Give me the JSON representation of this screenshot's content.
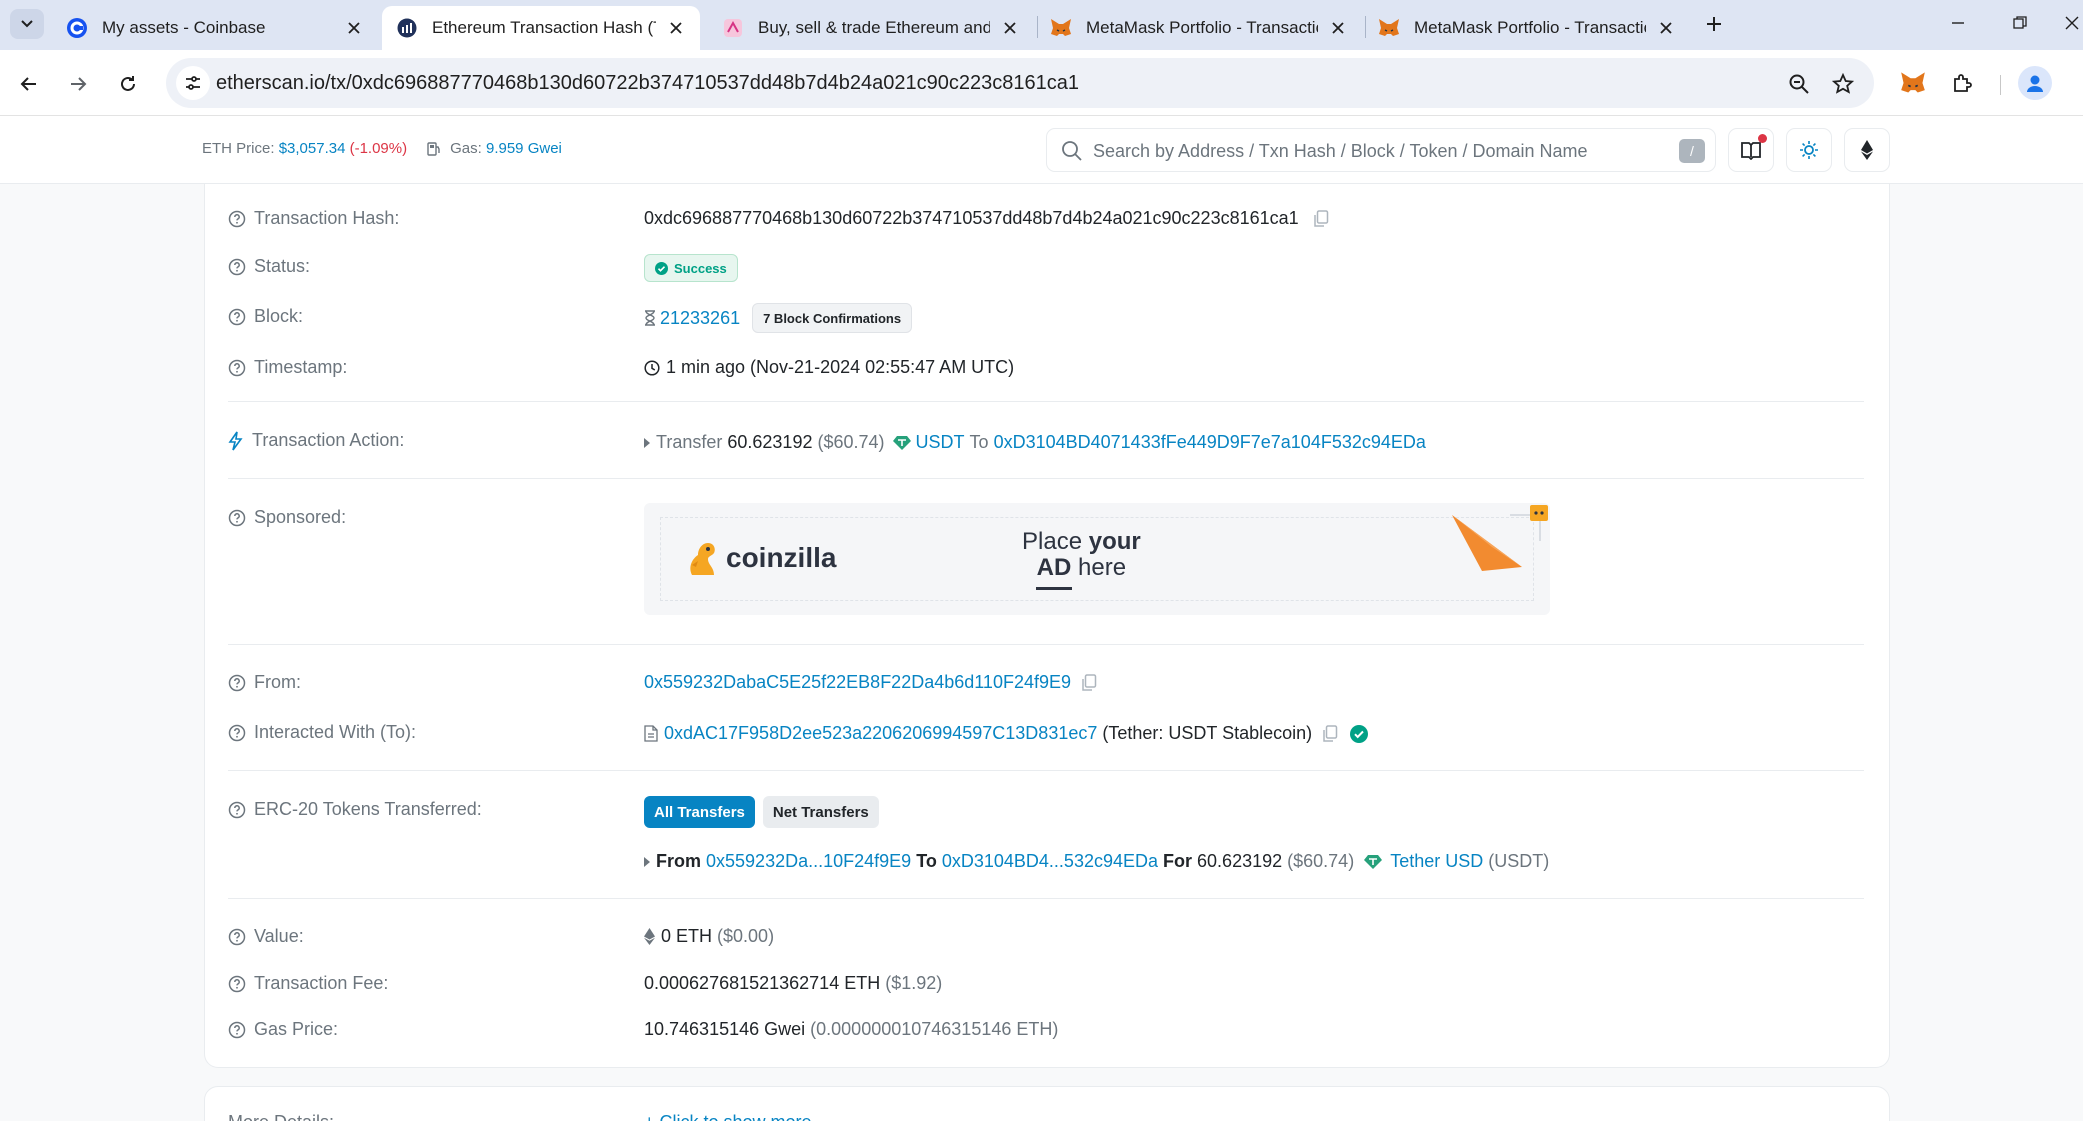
{
  "browser": {
    "tabs": [
      {
        "title": "My assets - Coinbase",
        "favicon": "coinbase-icon"
      },
      {
        "title": "Ethereum Transaction Hash (Txh",
        "favicon": "etherscan-icon"
      },
      {
        "title": "Buy, sell & trade Ethereum and",
        "favicon": "shop-icon"
      },
      {
        "title": "MetaMask Portfolio - Transactio",
        "favicon": "metamask-icon"
      },
      {
        "title": "MetaMask Portfolio - Transactio",
        "favicon": "metamask-icon"
      }
    ],
    "active_tab": 1,
    "url": "etherscan.io/tx/0xdc696887770468b130d60722b374710537dd48b7d4b24a021c90c223c8161ca1"
  },
  "header": {
    "eth_price_label": "ETH Price:",
    "eth_price": "$3,057.34",
    "eth_change": "(-1.09%)",
    "gas_label": "Gas:",
    "gas_value": "9.959 Gwei",
    "search_placeholder": "Search by Address / Txn Hash / Block / Token / Domain Name",
    "search_shortcut": "/"
  },
  "overview": {
    "tx_hash": {
      "label": "Transaction Hash:",
      "value": "0xdc696887770468b130d60722b374710537dd48b7d4b24a021c90c223c8161ca1"
    },
    "status": {
      "label": "Status:",
      "value": "Success"
    },
    "block": {
      "label": "Block:",
      "value": "21233261",
      "confirmations": "7 Block Confirmations"
    },
    "timestamp": {
      "label": "Timestamp:",
      "value": "1 min ago (Nov-21-2024 02:55:47 AM UTC)"
    },
    "action": {
      "label": "Transaction Action:",
      "verb": "Transfer",
      "amount": "60.623192",
      "usd": "($60.74)",
      "token": "USDT",
      "to_word": "To",
      "to_address": "0xD3104BD4071433fFe449D9F7e7a104F532c94EDa"
    },
    "sponsored": {
      "label": "Sponsored:",
      "brand": "coinzilla",
      "slogan_line1_a": "Place",
      "slogan_line1_b": "your",
      "slogan_line2_a": "AD",
      "slogan_line2_b": "here"
    },
    "from": {
      "label": "From:",
      "address": "0x559232DabaC5E25f22EB8F22Da4b6d110F24f9E9"
    },
    "to": {
      "label": "Interacted With (To):",
      "address": "0xdAC17F958D2ee523a2206206994597C13D831ec7",
      "name": "(Tether: USDT Stablecoin)"
    },
    "erc20": {
      "label": "ERC-20 Tokens Transferred:",
      "tab_all": "All Transfers",
      "tab_net": "Net Transfers",
      "from_word": "From",
      "from": "0x559232Da...10F24f9E9",
      "to_word": "To",
      "to": "0xD3104BD4...532c94EDa",
      "for_word": "For",
      "amount": "60.623192",
      "usd": "($60.74)",
      "token_name": "Tether USD",
      "token_symbol": "(USDT)"
    },
    "value": {
      "label": "Value:",
      "amount": "0 ETH",
      "usd": "($0.00)"
    },
    "fee": {
      "label": "Transaction Fee:",
      "amount": "0.000627681521362714 ETH",
      "usd": "($1.92)"
    },
    "gas_price": {
      "label": "Gas Price:",
      "amount": "10.746315146 Gwei",
      "eth": "(0.000000010746315146 ETH)"
    }
  },
  "more_details": {
    "label": "More Details:",
    "link": "+ Click to show more"
  },
  "colors": {
    "link": "#0784c3",
    "success": "#00a186",
    "negative": "#dc3545",
    "muted": "#6c757d"
  }
}
